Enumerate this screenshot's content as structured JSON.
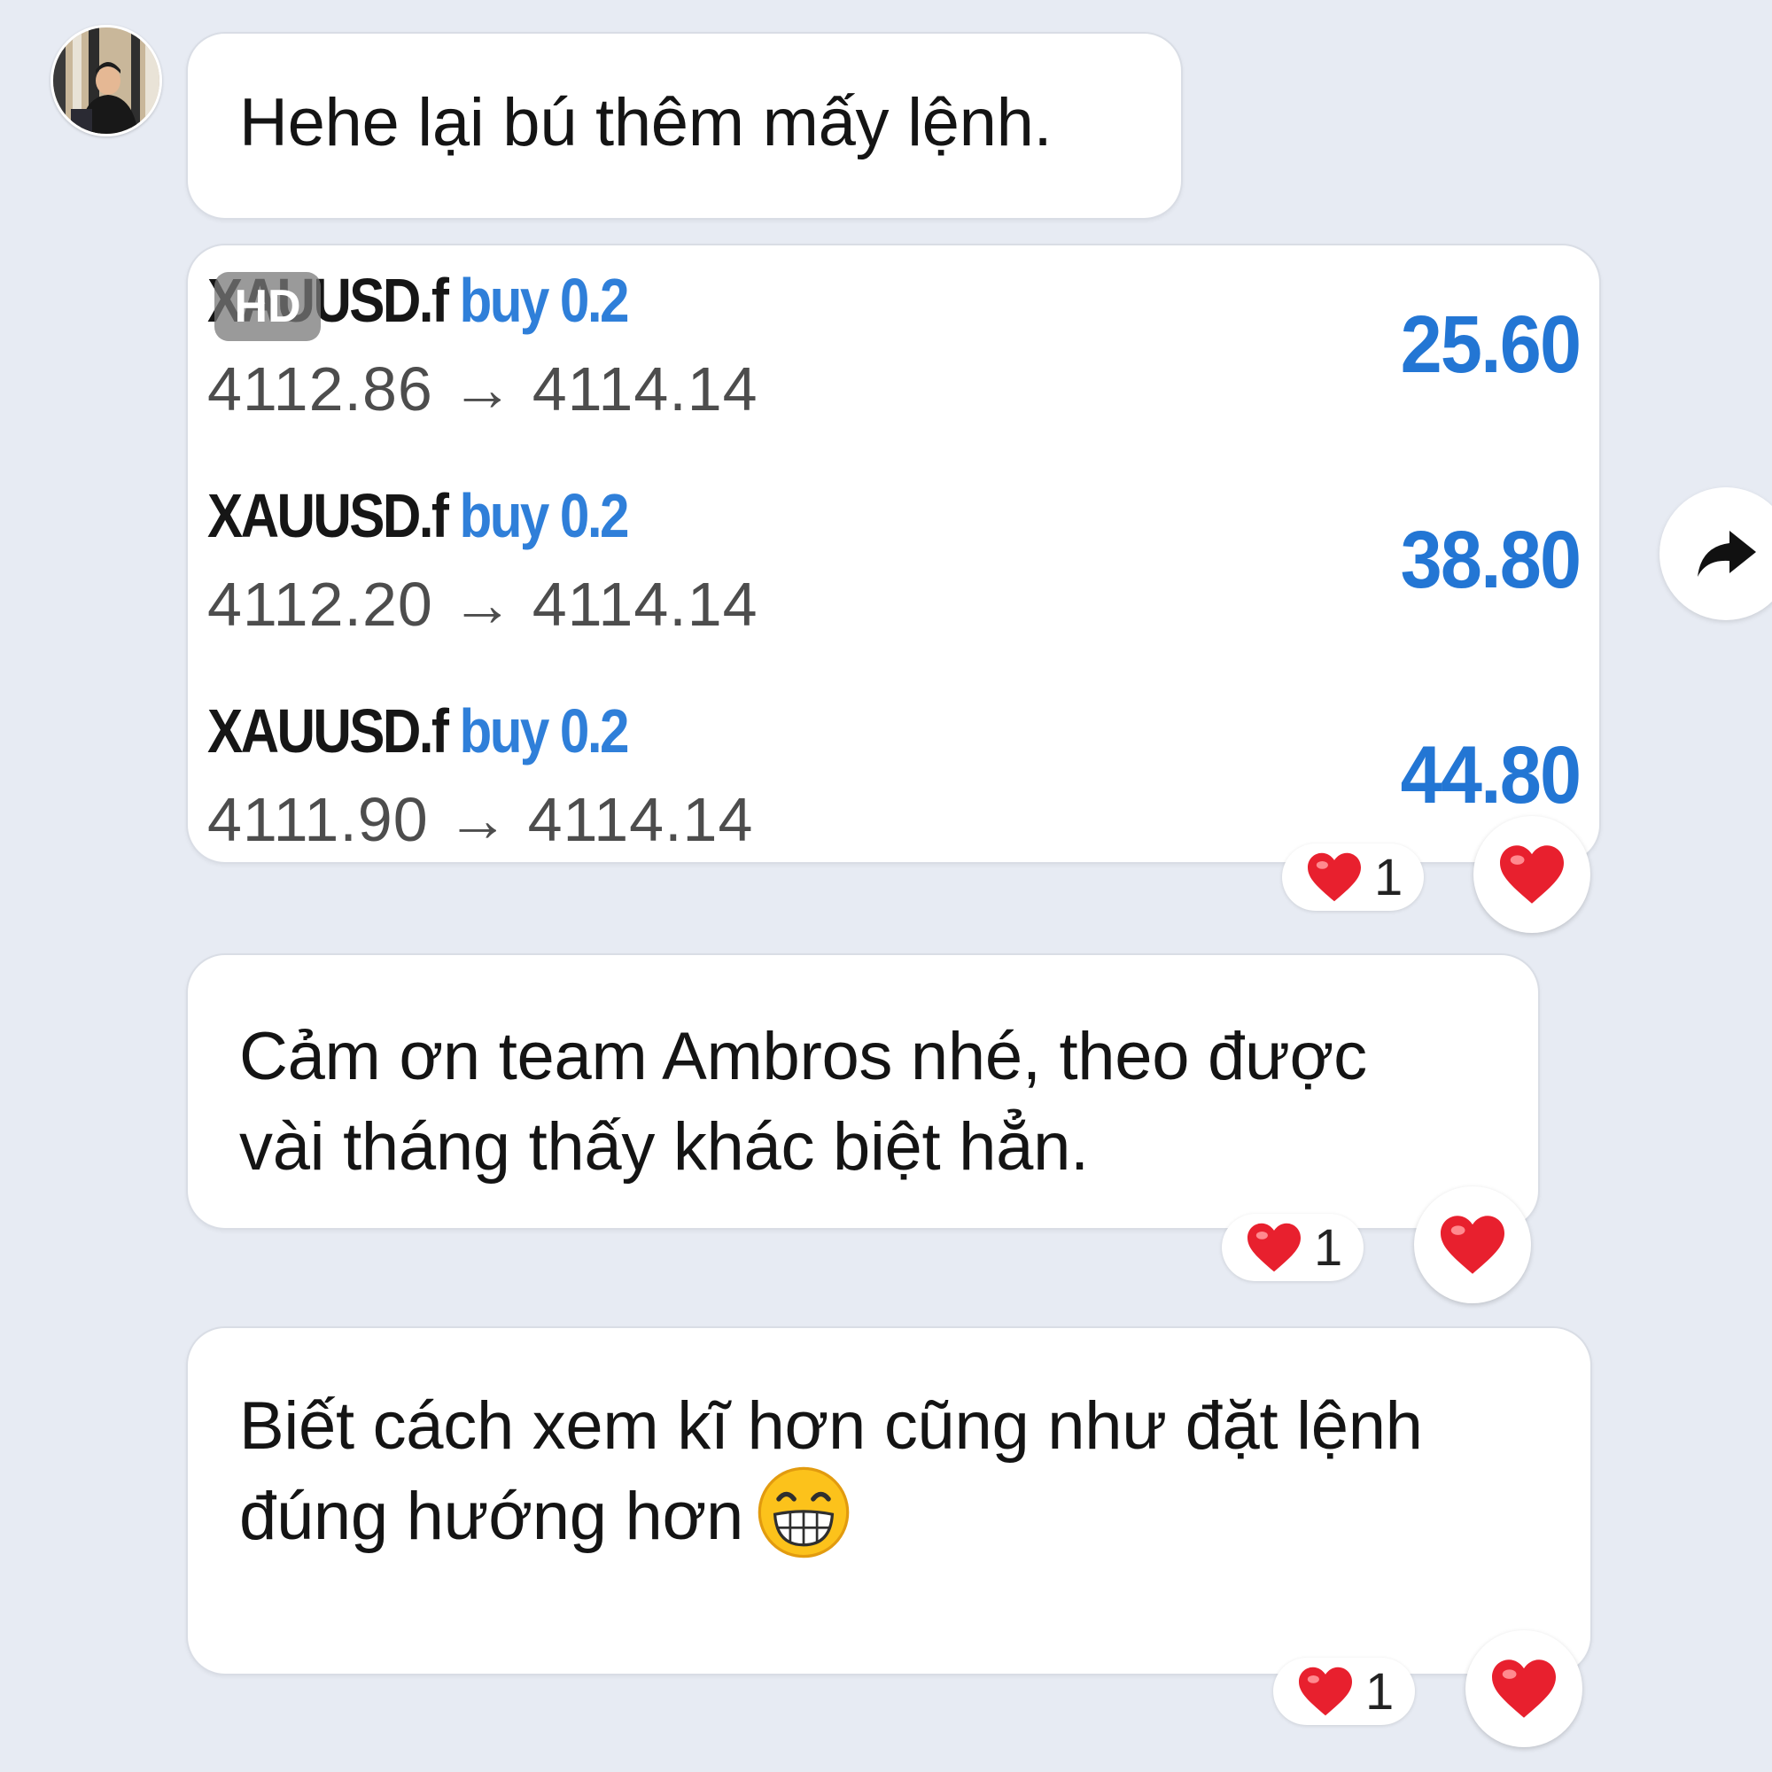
{
  "messages": [
    {
      "text": "Hehe lại bú thêm mấy lệnh."
    },
    {
      "line1": "Cảm ơn team Ambros nhé, theo được",
      "line2": "vài tháng thấy khác biệt hẳn."
    },
    {
      "line1": "Biết cách xem kĩ hơn cũng như đặt lệnh",
      "line2": "đúng hướng hơn",
      "emoji": "grinning-face-emoji"
    }
  ],
  "card": {
    "hd_badge": "HD",
    "trades": [
      {
        "symbol": "XAUUSD.f",
        "side": "buy 0.2",
        "open": "4112.86",
        "arrow": "→",
        "close": "4114.14",
        "profit": "25.60"
      },
      {
        "symbol": "XAUUSD.f",
        "side": "buy 0.2",
        "open": "4112.20",
        "arrow": "→",
        "close": "4114.14",
        "profit": "38.80"
      },
      {
        "symbol": "XAUUSD.f",
        "side": "buy 0.2",
        "open": "4111.90",
        "arrow": "→",
        "close": "4114.14",
        "profit": "44.80"
      }
    ]
  },
  "reactions": [
    {
      "count": "1",
      "icon": "heart-icon"
    },
    {
      "count": "1",
      "icon": "heart-icon"
    },
    {
      "count": "1",
      "icon": "heart-icon"
    }
  ],
  "colors": {
    "accent": "#2f7fd9",
    "heart": "#e8202e",
    "background": "#e7ebf3"
  }
}
